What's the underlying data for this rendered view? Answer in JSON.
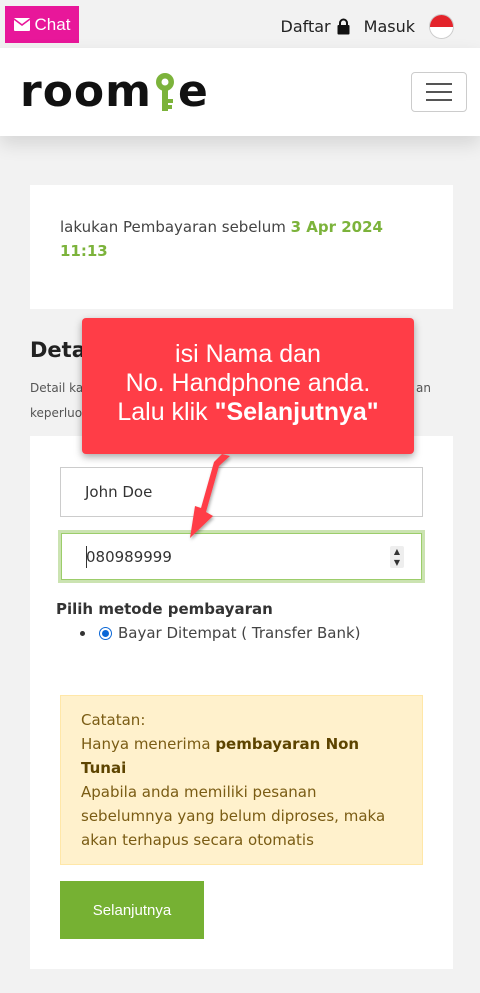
{
  "topbar": {
    "chat_label": "Chat",
    "register_label": "Daftar",
    "login_label": "Masuk",
    "language_flag": "indonesia-flag"
  },
  "header": {
    "logo_text_left": "room",
    "logo_text_right": "e",
    "accent_color": "#7cb33b"
  },
  "deadline": {
    "text": "lakukan Pembayaran sebelum",
    "date": "3 Apr 2024 11:13"
  },
  "section": {
    "title": "Deta",
    "desc_line1_left": "Detail ka",
    "desc_line1_right": "an",
    "desc_line2_left": "keperluo"
  },
  "form": {
    "name_value": "John Doe",
    "phone_value": "080989999",
    "payment_label": "Pilih metode pembayaran",
    "payment_option": "Bayar Ditempat ( Transfer Bank)",
    "next_button": "Selanjutnya"
  },
  "note": {
    "line1": "Catatan:",
    "line2_prefix": "Hanya menerima",
    "line2_bold": "pembayaran Non Tunai",
    "line3": "Apabila anda memiliki pesanan sebelumnya yang belum diproses, maka akan terhapus secara otomatis"
  },
  "callout": {
    "line1": "isi Nama dan",
    "line2": "No. Handphone anda.",
    "line3_prefix": "Lalu klik ",
    "line3_bold": "\"Selanjutnya\"",
    "color": "#ff3d47"
  }
}
